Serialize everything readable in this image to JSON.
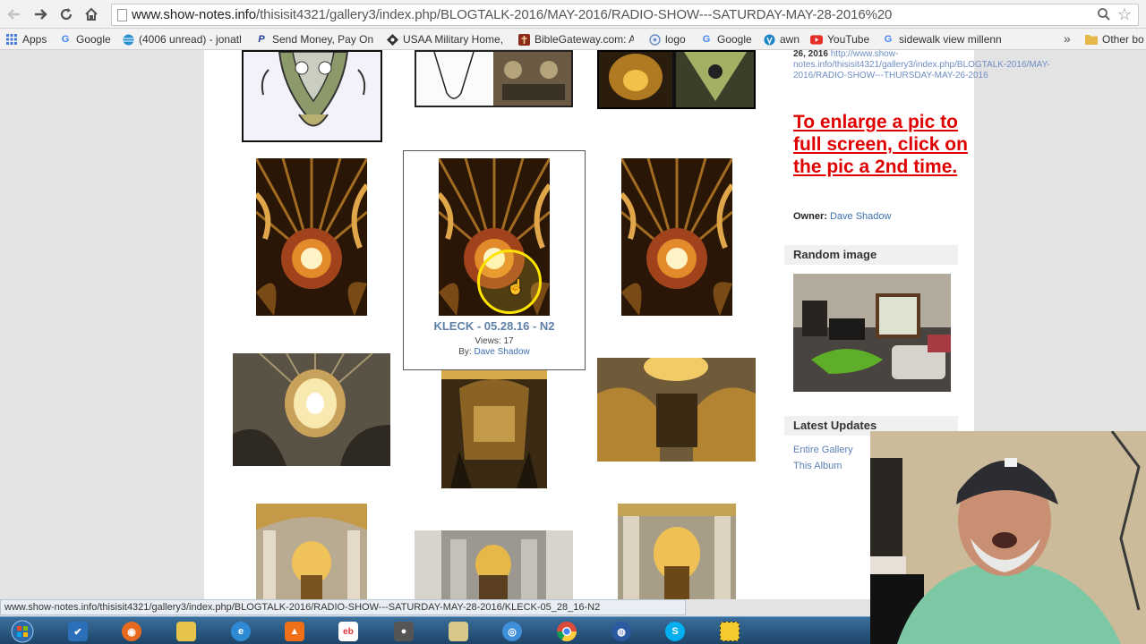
{
  "browser": {
    "url_host": "www.show-notes.info",
    "url_path": "/thisisit4321/gallery3/index.php/BLOGTALK-2016/MAY-2016/RADIO-SHOW---SATURDAY-MAY-28-2016%20",
    "bookmarks": [
      {
        "label": "Apps",
        "icon": "apps-grid-icon",
        "color": "#4a7bd4"
      },
      {
        "label": "Google",
        "icon": "google-icon",
        "color": "#4285f4"
      },
      {
        "label": "(4006 unread) - jonatl",
        "icon": "att-icon",
        "color": "#2a8fd0"
      },
      {
        "label": "Send Money, Pay Onl",
        "icon": "paypal-icon",
        "color": "#1c3f94"
      },
      {
        "label": "USAA Military Home,",
        "icon": "usaa-icon",
        "color": "#333333"
      },
      {
        "label": "BibleGateway.com: A",
        "icon": "biblegateway-icon",
        "color": "#8a2a1a"
      },
      {
        "label": "logo",
        "icon": "globe-icon",
        "color": "#6a8fc2"
      },
      {
        "label": "Google",
        "icon": "google-icon",
        "color": "#4285f4"
      },
      {
        "label": "awn",
        "icon": "awn-icon",
        "color": "#1a86c8"
      },
      {
        "label": "YouTube",
        "icon": "youtube-icon",
        "color": "#e52d27"
      },
      {
        "label": "sidewalk view millenn",
        "icon": "google-icon",
        "color": "#4285f4"
      }
    ],
    "bookmarks_overflow": "»",
    "other_bookmarks": "Other bo"
  },
  "gallery": {
    "hover_item": {
      "title": "KLECK - 05.28.16 - N2",
      "views": "Views: 17",
      "by_label": "By:",
      "by_name": "Dave Shadow"
    }
  },
  "sidebar": {
    "prev_link_date": "26, 2016",
    "prev_link_url": "http://www.show-notes.info/thisisit4321/gallery3/index.php/BLOGTALK-2016/MAY-2016/RADIO-SHOW---THURSDAY-MAY-26-2016",
    "enlarge_note": "To enlarge a pic to full screen, click on the pic a 2nd time.",
    "owner_label": "Owner:",
    "owner_name": "Dave Shadow",
    "random_image_heading": "Random image",
    "latest_updates_heading": "Latest Updates",
    "latest_links": [
      "Entire Gallery",
      "This Album"
    ]
  },
  "status_bar": "www.show-notes.info/thisisit4321/gallery3/index.php/BLOGTALK-2016/RADIO-SHOW---SATURDAY-MAY-28-2016/KLECK-05_28_16-N2",
  "taskbar": {
    "items": [
      {
        "icon": "windows-start-icon",
        "color": "#3a8f3a"
      },
      {
        "icon": "task-check-icon",
        "color": "#2b6fb8"
      },
      {
        "icon": "firefox-icon",
        "color": "#e86a1f"
      },
      {
        "icon": "folder-icon",
        "color": "#e6c34a"
      },
      {
        "icon": "internet-explorer-icon",
        "color": "#2f8ad6"
      },
      {
        "icon": "flame-app-icon",
        "color": "#f0701a"
      },
      {
        "icon": "ebay-icon",
        "color": "#ffffff"
      },
      {
        "icon": "camera-app-icon",
        "color": "#555555"
      },
      {
        "icon": "notes-app-icon",
        "color": "#d8c98a"
      },
      {
        "icon": "network-app-icon",
        "color": "#3f8fd8"
      },
      {
        "icon": "chrome-icon",
        "color": "#dd4b39"
      },
      {
        "icon": "google-earth-icon",
        "color": "#2c5aa0"
      },
      {
        "icon": "skype-icon",
        "color": "#00aff0"
      },
      {
        "icon": "screen-capture-icon",
        "color": "#f3cb2f"
      }
    ]
  }
}
